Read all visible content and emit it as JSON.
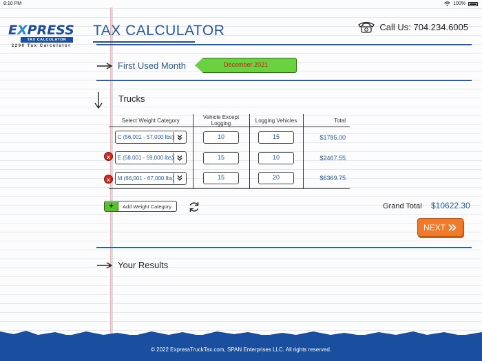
{
  "status_bar": {
    "time": "8:10 PM",
    "battery": "100%"
  },
  "logo": {
    "word_e": "E",
    "word_x": "X",
    "word_rest": "PRESS",
    "strip": "TAX CALCULATOR",
    "sub": "2290 Tax Calculator"
  },
  "header": {
    "title": "TAX CALCULATOR",
    "phone_label": "Call Us: 704.234.6005"
  },
  "first_used": {
    "label": "First Used Month",
    "value": "December 2021"
  },
  "trucks": {
    "label": "Trucks",
    "columns": [
      "Select Weight Category",
      "Vehicle Except Logging",
      "Logging Vehicles",
      "Total"
    ],
    "rows": [
      {
        "category": "C (56,001 - 57,000 lbs)",
        "except_logging": "10",
        "logging": "15",
        "total": "$1785.00",
        "deletable": false
      },
      {
        "category": "E (58,001 - 59,000 lbs)",
        "except_logging": "15",
        "logging": "10",
        "total": "$2467.55",
        "deletable": true
      },
      {
        "category": "M (66,001 - 67,000 lbs)",
        "except_logging": "15",
        "logging": "20",
        "total": "$6369.75",
        "deletable": true
      }
    ],
    "add_label": "Add Weight Category",
    "add_symbol": "+",
    "delete_symbol": "x"
  },
  "grand_total": {
    "label": "Grand Total",
    "value": "$10622.30"
  },
  "next_button": {
    "label": "NEXT"
  },
  "results": {
    "label": "Your Results"
  },
  "footer": {
    "text": "© 2022 ExpressTruckTax.com, SPAN Enterprises LLC. All rights reserved."
  },
  "colors": {
    "accent": "#2457a8",
    "green": "#6ad13f",
    "orange": "#f07a2a",
    "footer": "#1a4fa0",
    "delete": "#d42a1e"
  },
  "icons": [
    "wifi-icon",
    "battery-icon",
    "telephone-icon",
    "arrow-right-icon",
    "arrow-down-icon",
    "chevron-double-down-icon",
    "refresh-icon",
    "double-chevron-right-icon"
  ]
}
